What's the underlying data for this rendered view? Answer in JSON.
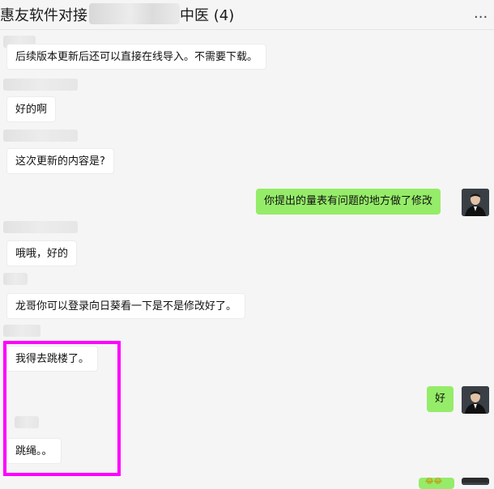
{
  "header": {
    "title_prefix": "惠友软件对接",
    "title_suffix": "中医 (4)",
    "more_icon": "more-dots-icon",
    "more_label": "..."
  },
  "messages": [
    {
      "side": "in",
      "sender_redacted": true,
      "text": "后续版本更新后还可以直接在线导入。不需要下载。"
    },
    {
      "side": "in",
      "sender_redacted": true,
      "text": "好的啊"
    },
    {
      "side": "in",
      "sender_redacted": true,
      "text": "这次更新的内容是?"
    },
    {
      "side": "out",
      "text": "你提出的量表有问题的地方做了修改"
    },
    {
      "side": "in",
      "sender_redacted": true,
      "text": "哦哦，好的"
    },
    {
      "side": "in",
      "sender_redacted": true,
      "text": "龙哥你可以登录向日葵看一下是不是修改好了。"
    },
    {
      "side": "in",
      "sender_redacted": true,
      "text": "我得去跳楼了。"
    },
    {
      "side": "out",
      "text": "好"
    },
    {
      "side": "in",
      "sender_redacted": true,
      "text": "跳绳。。"
    }
  ],
  "partial_last": {
    "side": "out",
    "emoji": "😂😂"
  },
  "colors": {
    "background": "#f5f5f5",
    "incoming_bubble": "#ffffff",
    "outgoing_bubble": "#95ec69",
    "highlight_box": "#ff00ff"
  }
}
